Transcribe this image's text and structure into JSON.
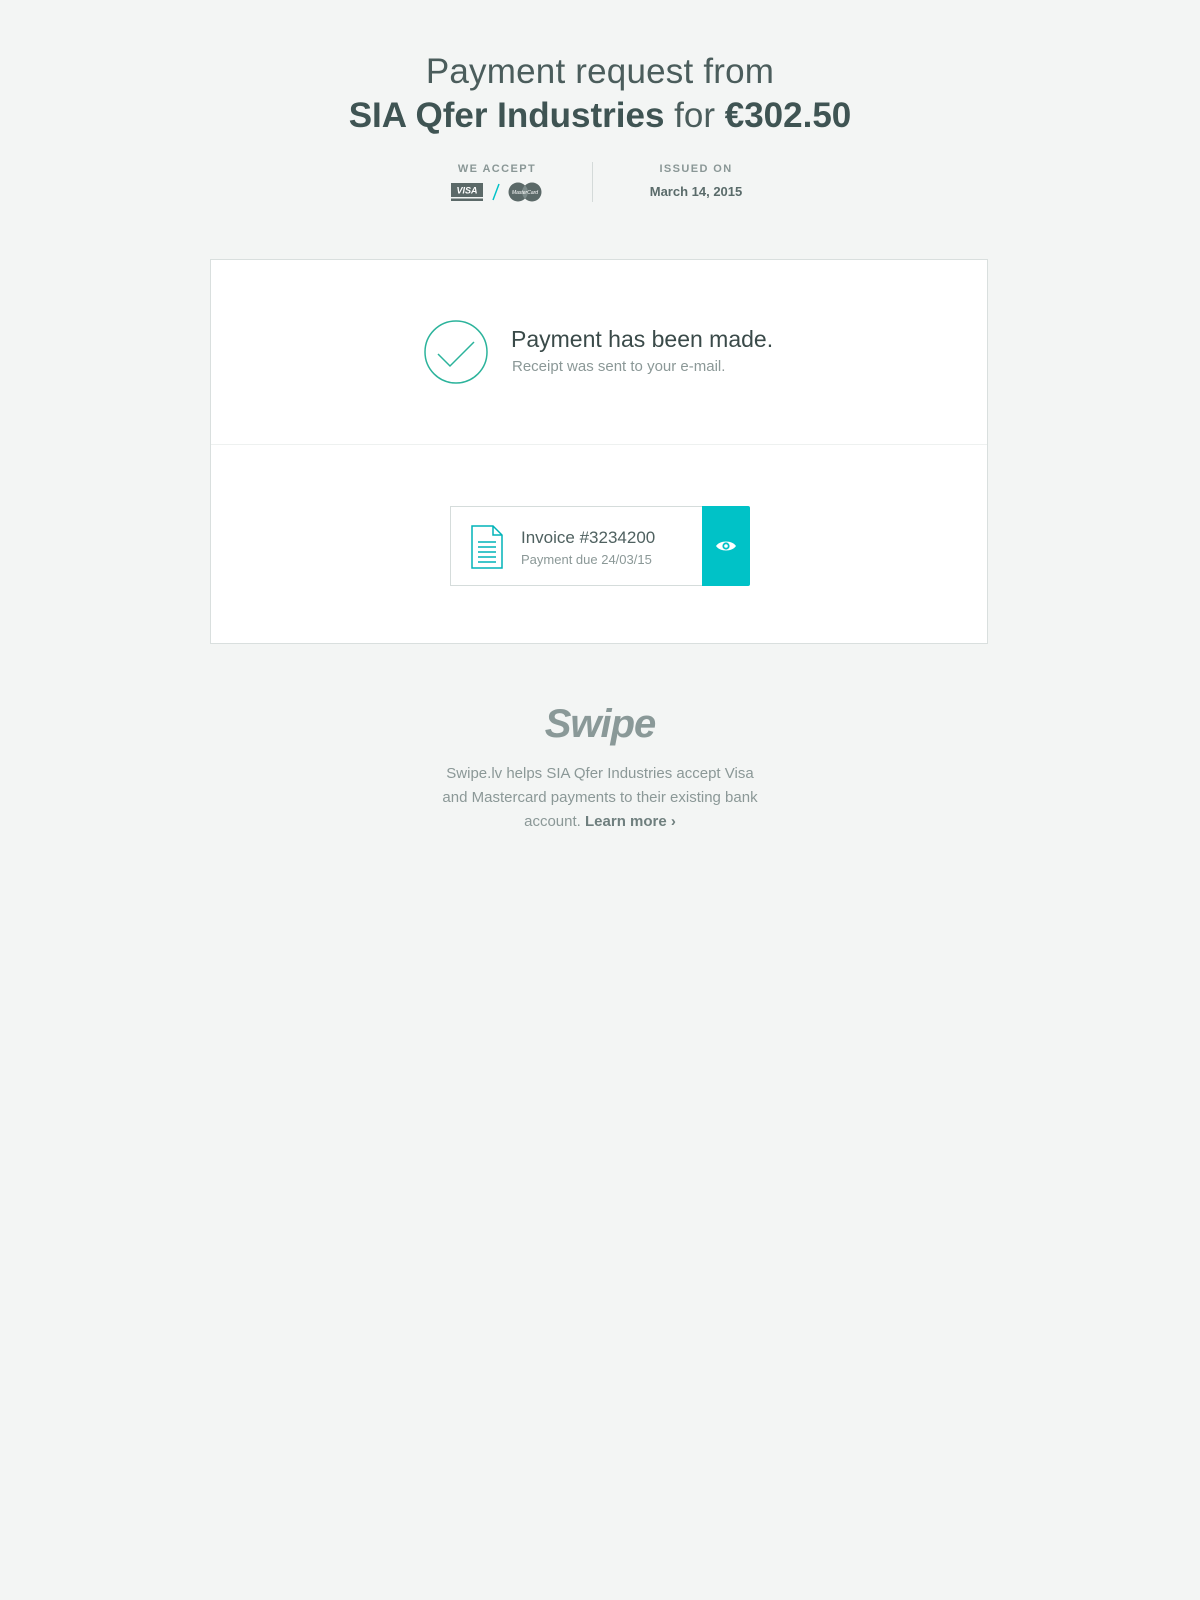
{
  "header": {
    "title_prefix": "Payment request from",
    "merchant": "SIA Qfer Industries",
    "connector": "for",
    "amount": "€302.50"
  },
  "meta": {
    "accept_label": "WE ACCEPT",
    "cards": [
      "VISA",
      "MasterCard"
    ],
    "issued_label": "ISSUED ON",
    "issued_date": "March 14, 2015"
  },
  "status": {
    "title": "Payment has been made.",
    "subtitle": "Receipt was sent to your e-mail."
  },
  "invoice": {
    "title": "Invoice #3234200",
    "due": "Payment due 24/03/15",
    "view_icon": "eye-icon"
  },
  "footer": {
    "brand": "Swipe",
    "text": "Swipe.lv helps SIA Qfer Industries accept Visa and Mastercard payments to their existing bank account.",
    "learn_more": "Learn more ›"
  },
  "colors": {
    "background": "#f3f5f4",
    "accent": "#00c2c7",
    "success": "#2bb39b",
    "text_dark": "#3f5453",
    "text_muted": "#8b9897"
  }
}
